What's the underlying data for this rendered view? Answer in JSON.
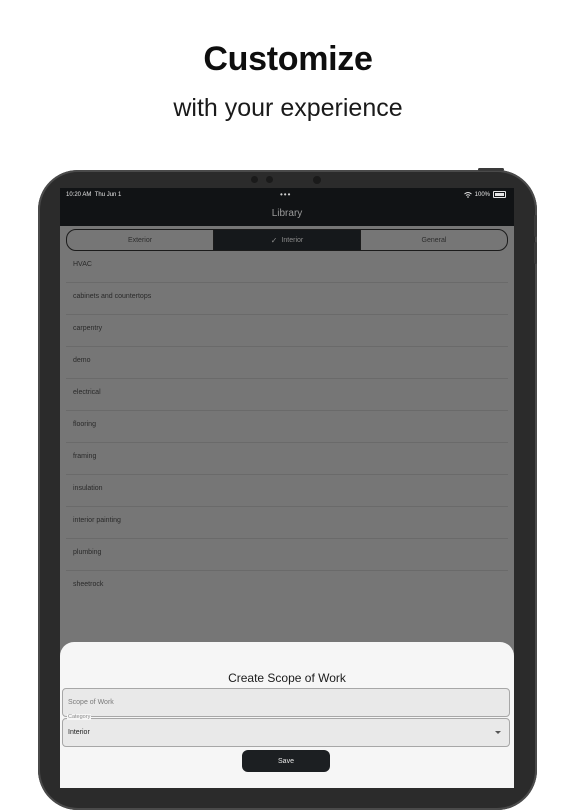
{
  "promo": {
    "headline": "Customize",
    "subheadline": "with your experience"
  },
  "status_bar": {
    "time": "10:20 AM",
    "date": "Thu Jun 1",
    "dots": "•••",
    "battery_percent": "100%"
  },
  "nav": {
    "title": "Library"
  },
  "segments": {
    "items": [
      {
        "label": "Exterior",
        "selected": false
      },
      {
        "label": "Interior",
        "selected": true
      },
      {
        "label": "General",
        "selected": false
      }
    ],
    "check_icon": "✓"
  },
  "library_items": [
    "HVAC",
    "cabinets and countertops",
    "carpentry",
    "demo",
    "electrical",
    "flooring",
    "framing",
    "insulation",
    "interior painting",
    "plumbing",
    "sheetrock"
  ],
  "sheet": {
    "title": "Create Scope of Work",
    "scope_placeholder": "Scope of Work",
    "category_label": "Category",
    "category_value": "Interior",
    "save_label": "Save"
  },
  "colors": {
    "screen_dim": "#767676",
    "nav_bg": "#111315",
    "sheet_bg": "#f6f6f6",
    "button_bg": "#1c1f22"
  }
}
